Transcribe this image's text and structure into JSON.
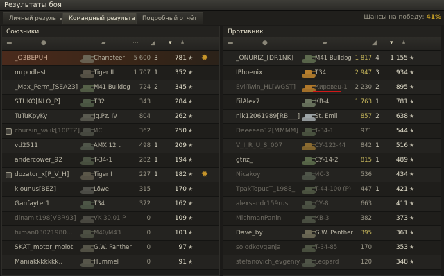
{
  "window": {
    "title": "Результаты боя"
  },
  "tabs": [
    {
      "label": "Личный результат"
    },
    {
      "label": "Командный результат"
    },
    {
      "label": "Подробный отчёт"
    }
  ],
  "win_chance": {
    "label": "Шансы на победу:",
    "value": "41%"
  },
  "allies": {
    "title": "Союзники",
    "rows": [
      {
        "name": "_O3BEPUH",
        "tank": "Charioteer",
        "dmg": "5 600",
        "kills": "3",
        "xp": "781",
        "me": true,
        "medal": true,
        "tank_color": "#6b6656"
      },
      {
        "name": "mrpodlest",
        "tank": "Tiger II",
        "dmg": "1 707",
        "kills": "1",
        "xp": "352",
        "tank_color": "#595448"
      },
      {
        "name": "_Max_Perm_[SEA23]",
        "tank": "M41 Bulldog",
        "dmg": "724",
        "kills": "2",
        "xp": "345",
        "tank_color": "#556048"
      },
      {
        "name": "STUKO[NLO_P]",
        "tank": "T32",
        "dmg": "343",
        "kills": "",
        "xp": "284",
        "tank_color": "#4e5a46"
      },
      {
        "name": "TuTuKpyKy",
        "tank": "Jg.Pz. IV",
        "dmg": "804",
        "kills": "",
        "xp": "262",
        "tank_color": "#5a5a50"
      },
      {
        "name": "chursin_valik[10PTZ]",
        "tank": "ИС",
        "dmg": "362",
        "kills": "",
        "xp": "250",
        "tk_icon": true,
        "dead": true,
        "tank_color": "#4a4c44"
      },
      {
        "name": "vd2511",
        "tank": "AMX 12 t",
        "dmg": "498",
        "kills": "1",
        "xp": "209",
        "tank_color": "#4f5549"
      },
      {
        "name": "andercower_92",
        "tank": "T-34-1",
        "dmg": "282",
        "kills": "1",
        "xp": "194",
        "tank_color": "#4b5343"
      },
      {
        "name": "dozator_x[P_V_H]",
        "tank": "Tiger I",
        "dmg": "227",
        "kills": "1",
        "xp": "182",
        "tk_icon": true,
        "medal": true,
        "tank_color": "#5b5749"
      },
      {
        "name": "klounus[BEZ]",
        "tank": "Löwe",
        "dmg": "315",
        "kills": "",
        "xp": "170",
        "tank_color": "#50504a"
      },
      {
        "name": "Ganfayter1",
        "tank": "T34",
        "dmg": "372",
        "kills": "",
        "xp": "162",
        "tank_color": "#4d5646"
      },
      {
        "name": "dinamit198[VBR93]",
        "tank": "VK 30.01 P",
        "dmg": "0",
        "kills": "",
        "xp": "109",
        "dead": true,
        "tank_color": "#4c4b44"
      },
      {
        "name": "tuman03021980...",
        "tank": "M40/M43",
        "dmg": "0",
        "kills": "",
        "xp": "103",
        "dead": true,
        "tank_color": "#4d5043"
      },
      {
        "name": "SKAT_motor_molot",
        "tank": "G.W. Panther",
        "dmg": "0",
        "kills": "",
        "xp": "97",
        "tank_color": "#555448"
      },
      {
        "name": "Maniakkkkkkk..",
        "tank": "Hummel",
        "dmg": "0",
        "kills": "",
        "xp": "91",
        "tank_color": "#57564a"
      }
    ]
  },
  "enemies": {
    "title": "Противник",
    "rows": [
      {
        "name": "_ONURIZ_[DR1NK]",
        "tank": "M41 Bulldog",
        "dmg": "1 817",
        "kills": "4",
        "xp": "1 155",
        "hi": true,
        "tank_color": "#5d6a4e"
      },
      {
        "name": "IPhoenix",
        "tank": "T34",
        "dmg": "2 947",
        "kills": "3",
        "xp": "934",
        "hi": true,
        "tank_color": "#b8802e"
      },
      {
        "name": "EvilTwin_HL[WGST]",
        "tank": "Кировец-1",
        "dmg": "2 230",
        "kills": "2",
        "xp": "895",
        "dead": true,
        "underline": true,
        "tank_color": "#b0782a"
      },
      {
        "name": "FilAlex7",
        "tank": "КВ-4",
        "dmg": "1 763",
        "kills": "1",
        "xp": "781",
        "hi": true,
        "tank_color": "#6c7560"
      },
      {
        "name": "nik12061989[RB___]",
        "tank": "St. Emil",
        "dmg": "857",
        "kills": "2",
        "xp": "638",
        "hi": true,
        "tank_color": "#9da4a6"
      },
      {
        "name": "Deeeeen12[MMMM]",
        "tank": "T-34-1",
        "dmg": "971",
        "kills": "",
        "xp": "544",
        "dead": true,
        "tank_color": "#4d5543"
      },
      {
        "name": "V_I_R_U_S_007",
        "tank": "СУ-122-44",
        "dmg": "842",
        "kills": "1",
        "xp": "516",
        "dead": true,
        "tank_color": "#8a6a30"
      },
      {
        "name": "gtnz_",
        "tank": "СУ-14-2",
        "dmg": "815",
        "kills": "1",
        "xp": "489",
        "hi": true,
        "tank_color": "#5b6a4b"
      },
      {
        "name": "Nicakoy",
        "tank": "ИС-3",
        "dmg": "536",
        "kills": "",
        "xp": "434",
        "dead": true,
        "tank_color": "#4e5448"
      },
      {
        "name": "TpakTopucT_1988_",
        "tank": "T-44-100 (P)",
        "dmg": "447",
        "kills": "1",
        "xp": "421",
        "dead": true,
        "tank_color": "#4f5744"
      },
      {
        "name": "alexsandr159rus",
        "tank": "СУ-8",
        "dmg": "663",
        "kills": "",
        "xp": "411",
        "dead": true,
        "tank_color": "#4c5244"
      },
      {
        "name": "MichmanPanin",
        "tank": "КВ-3",
        "dmg": "382",
        "kills": "",
        "xp": "373",
        "dead": true,
        "tank_color": "#4d5245"
      },
      {
        "name": "Dave_by",
        "tank": "G.W. Panther",
        "dmg": "395",
        "kills": "",
        "xp": "361",
        "hi": true,
        "tank_color": "#6e6a56"
      },
      {
        "name": "solodkovgenja",
        "tank": "T-34-85",
        "dmg": "170",
        "kills": "",
        "xp": "353",
        "dead": true,
        "tank_color": "#4d5343"
      },
      {
        "name": "stefanovich_evgeniy..",
        "tank": "Leopard",
        "dmg": "120",
        "kills": "",
        "xp": "348",
        "dead": true,
        "tank_color": "#4f5447"
      }
    ]
  },
  "icons": {
    "medal": "✹",
    "star": "★",
    "tk": "▪",
    "col_vehicle": "▬",
    "col_player": "●",
    "col_tank": "▰",
    "col_damage": "⋯",
    "col_kills": "◢",
    "col_sort": "▾",
    "col_xp": "★"
  }
}
